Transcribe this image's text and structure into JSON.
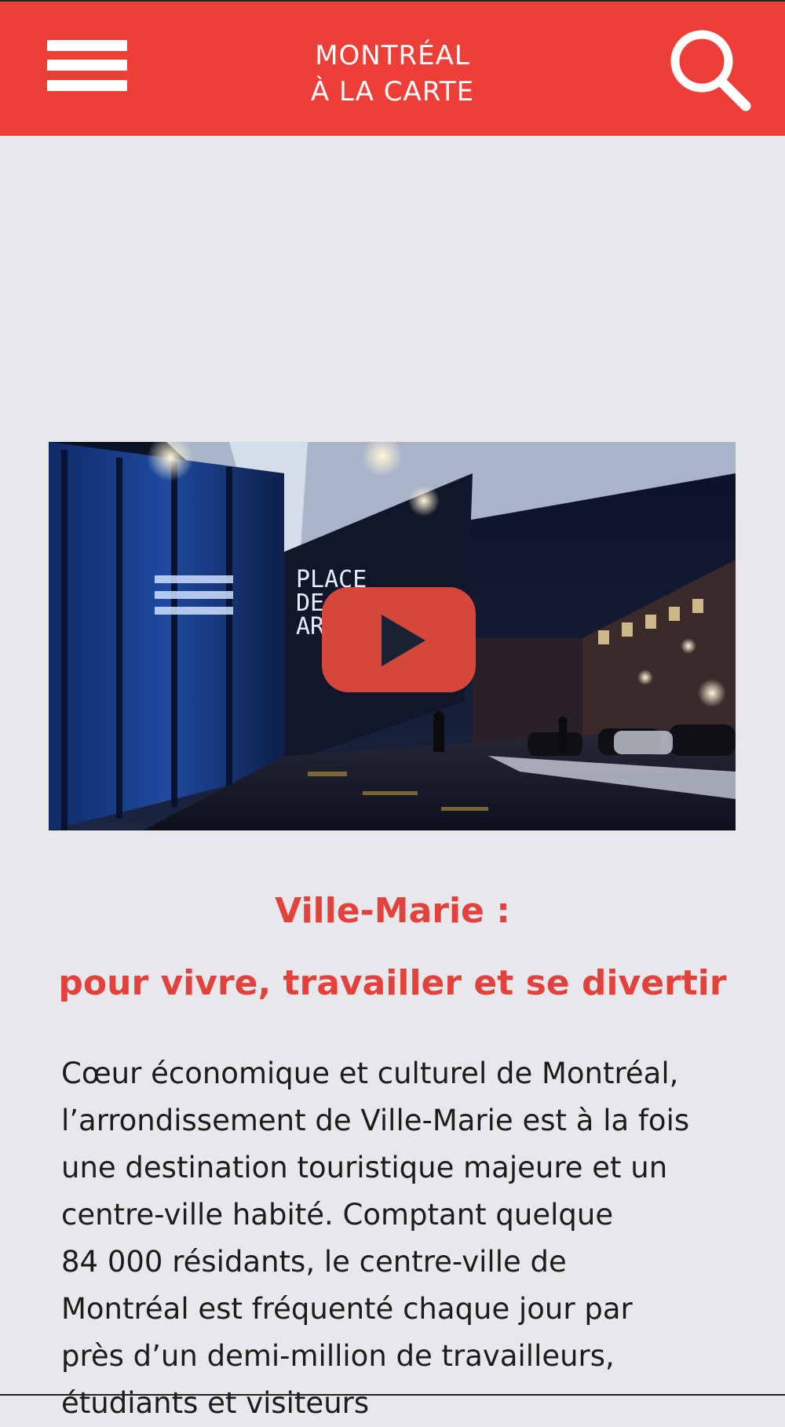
{
  "header": {
    "logo_line1": "MONTRÉAL",
    "logo_line2": "À LA CARTE",
    "background_color": "#ee3e38",
    "menu_icon": "hamburger-menu-icon",
    "search_icon": "search-icon"
  },
  "video": {
    "sign_line1": "PLACE",
    "sign_line2": "DE",
    "sign_line3": "AR",
    "play_icon": "play-icon",
    "play_color": "#e04a3c"
  },
  "article": {
    "heading_line1": "Ville-Marie :",
    "heading_line2": "pour vivre, travailler et se divertir",
    "heading_color": "#e3423c",
    "body_lines": [
      "Cœur économique et culturel de Montréal,",
      "l’arrondissement de Ville-Marie est à la fois",
      "une destination touristique majeure et un",
      "centre-ville habité. Comptant quelque",
      "84 000 résidants, le centre-ville de",
      "Montréal est fréquenté chaque jour par",
      "près d’un demi-million de travailleurs,",
      "étudiants et visiteurs"
    ]
  }
}
